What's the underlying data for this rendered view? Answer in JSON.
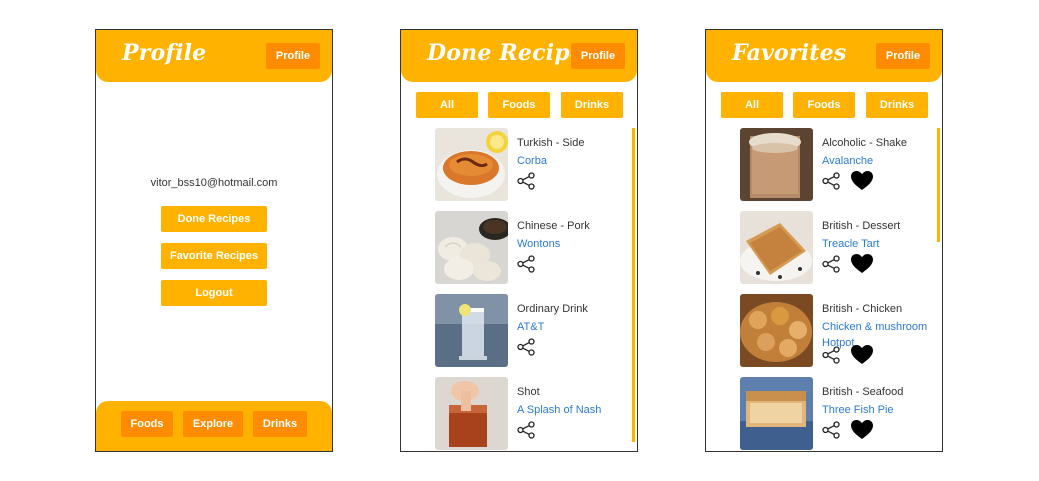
{
  "profile_screen": {
    "title": "Profile",
    "profile_button": "Profile",
    "email": "vitor_bss10@hotmail.com",
    "buttons": [
      "Done Recipes",
      "Favorite Recipes",
      "Logout"
    ],
    "footer": [
      "Foods",
      "Explore",
      "Drinks"
    ]
  },
  "done_screen": {
    "title": "Done Recipes",
    "profile_button": "Profile",
    "filters": [
      "All",
      "Foods",
      "Drinks"
    ],
    "recipes": [
      {
        "category": "Turkish - Side",
        "name": "Corba",
        "image": "lentil-soup"
      },
      {
        "category": "Chinese - Pork",
        "name": "Wontons",
        "image": "dumplings"
      },
      {
        "category": "Ordinary Drink",
        "name": "AT&T",
        "image": "clear-drink"
      },
      {
        "category": "Shot",
        "name": "A Splash of Nash",
        "image": "red-shot"
      }
    ]
  },
  "favorites_screen": {
    "title": "Favorites",
    "profile_button": "Profile",
    "filters": [
      "All",
      "Foods",
      "Drinks"
    ],
    "recipes": [
      {
        "category": "Alcoholic - Shake",
        "name": "Avalanche",
        "image": "shake"
      },
      {
        "category": "British - Dessert",
        "name": "Treacle Tart",
        "image": "tart"
      },
      {
        "category": "British - Chicken",
        "name": "Chicken & mushroom Hotpot",
        "image": "hotpot"
      },
      {
        "category": "British - Seafood",
        "name": "Three Fish Pie",
        "image": "fish-pie"
      }
    ]
  },
  "colors": {
    "primary": "#ffb300",
    "accent": "#ff8c00",
    "link": "#2b7bd6"
  },
  "icons": [
    "share-icon",
    "heart-icon"
  ]
}
